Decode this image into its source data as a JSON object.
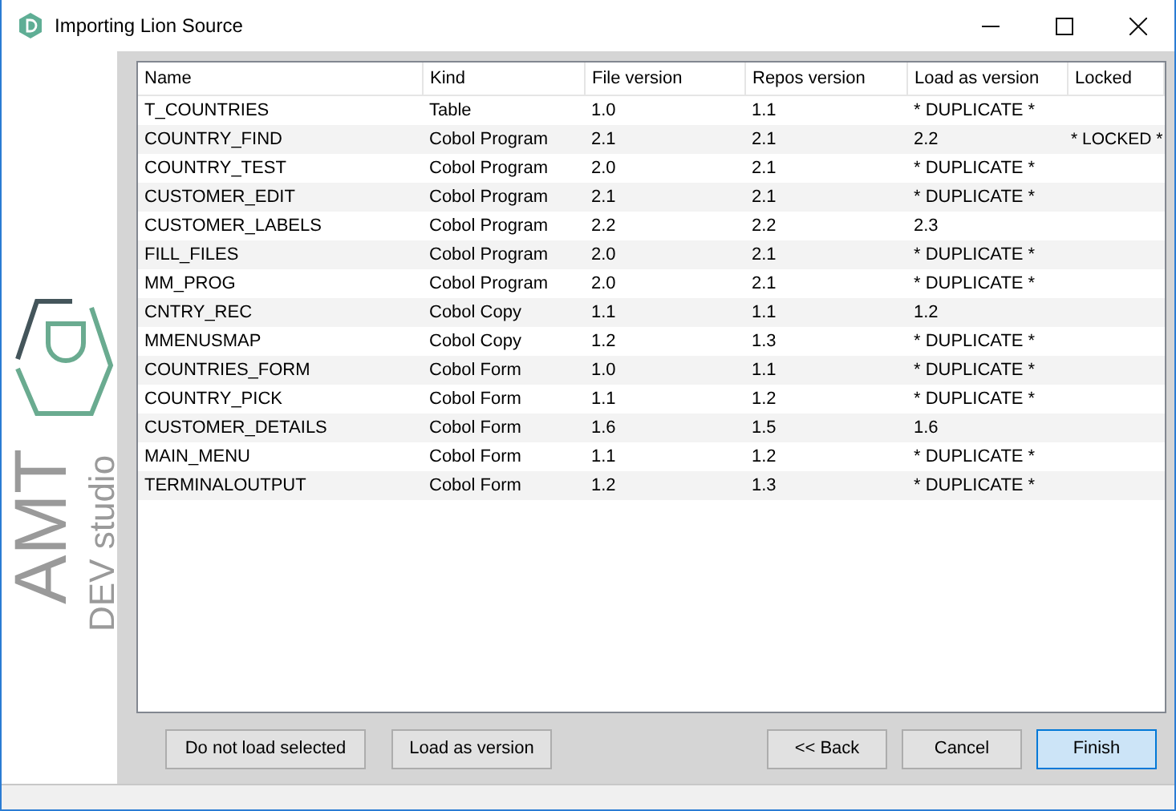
{
  "window": {
    "title": "Importing Lion Source"
  },
  "logo": {
    "brand": "AMT",
    "product": "DEV studio"
  },
  "table": {
    "columns": [
      "Name",
      "Kind",
      "File version",
      "Repos version",
      "Load as version",
      "Locked"
    ],
    "rows": [
      [
        "T_COUNTRIES",
        "Table",
        "1.0",
        "1.1",
        "* DUPLICATE *",
        ""
      ],
      [
        "COUNTRY_FIND",
        "Cobol Program",
        "2.1",
        "2.1",
        "2.2",
        "* LOCKED *"
      ],
      [
        "COUNTRY_TEST",
        "Cobol Program",
        "2.0",
        "2.1",
        "* DUPLICATE *",
        ""
      ],
      [
        "CUSTOMER_EDIT",
        "Cobol Program",
        "2.1",
        "2.1",
        "* DUPLICATE *",
        ""
      ],
      [
        "CUSTOMER_LABELS",
        "Cobol Program",
        "2.2",
        "2.2",
        "2.3",
        ""
      ],
      [
        "FILL_FILES",
        "Cobol Program",
        "2.0",
        "2.1",
        "* DUPLICATE *",
        ""
      ],
      [
        "MM_PROG",
        "Cobol Program",
        "2.0",
        "2.1",
        "* DUPLICATE *",
        ""
      ],
      [
        "CNTRY_REC",
        "Cobol Copy",
        "1.1",
        "1.1",
        "1.2",
        ""
      ],
      [
        "MMENUSMAP",
        "Cobol Copy",
        "1.2",
        "1.3",
        "* DUPLICATE *",
        ""
      ],
      [
        "COUNTRIES_FORM",
        "Cobol Form",
        "1.0",
        "1.1",
        "* DUPLICATE *",
        ""
      ],
      [
        "COUNTRY_PICK",
        "Cobol Form",
        "1.1",
        "1.2",
        "* DUPLICATE *",
        ""
      ],
      [
        "CUSTOMER_DETAILS",
        "Cobol Form",
        "1.6",
        "1.5",
        "1.6",
        ""
      ],
      [
        "MAIN_MENU",
        "Cobol Form",
        "1.1",
        "1.2",
        "* DUPLICATE *",
        ""
      ],
      [
        "TERMINALOUTPUT",
        "Cobol Form",
        "1.2",
        "1.3",
        "* DUPLICATE *",
        ""
      ]
    ]
  },
  "buttons_left": [
    {
      "label": "Do not load selected"
    },
    {
      "label": "Load as version"
    }
  ],
  "buttons_right": [
    {
      "label": "<< Back",
      "default": false
    },
    {
      "label": "Cancel",
      "default": false
    },
    {
      "label": "Finish",
      "default": true
    }
  ]
}
